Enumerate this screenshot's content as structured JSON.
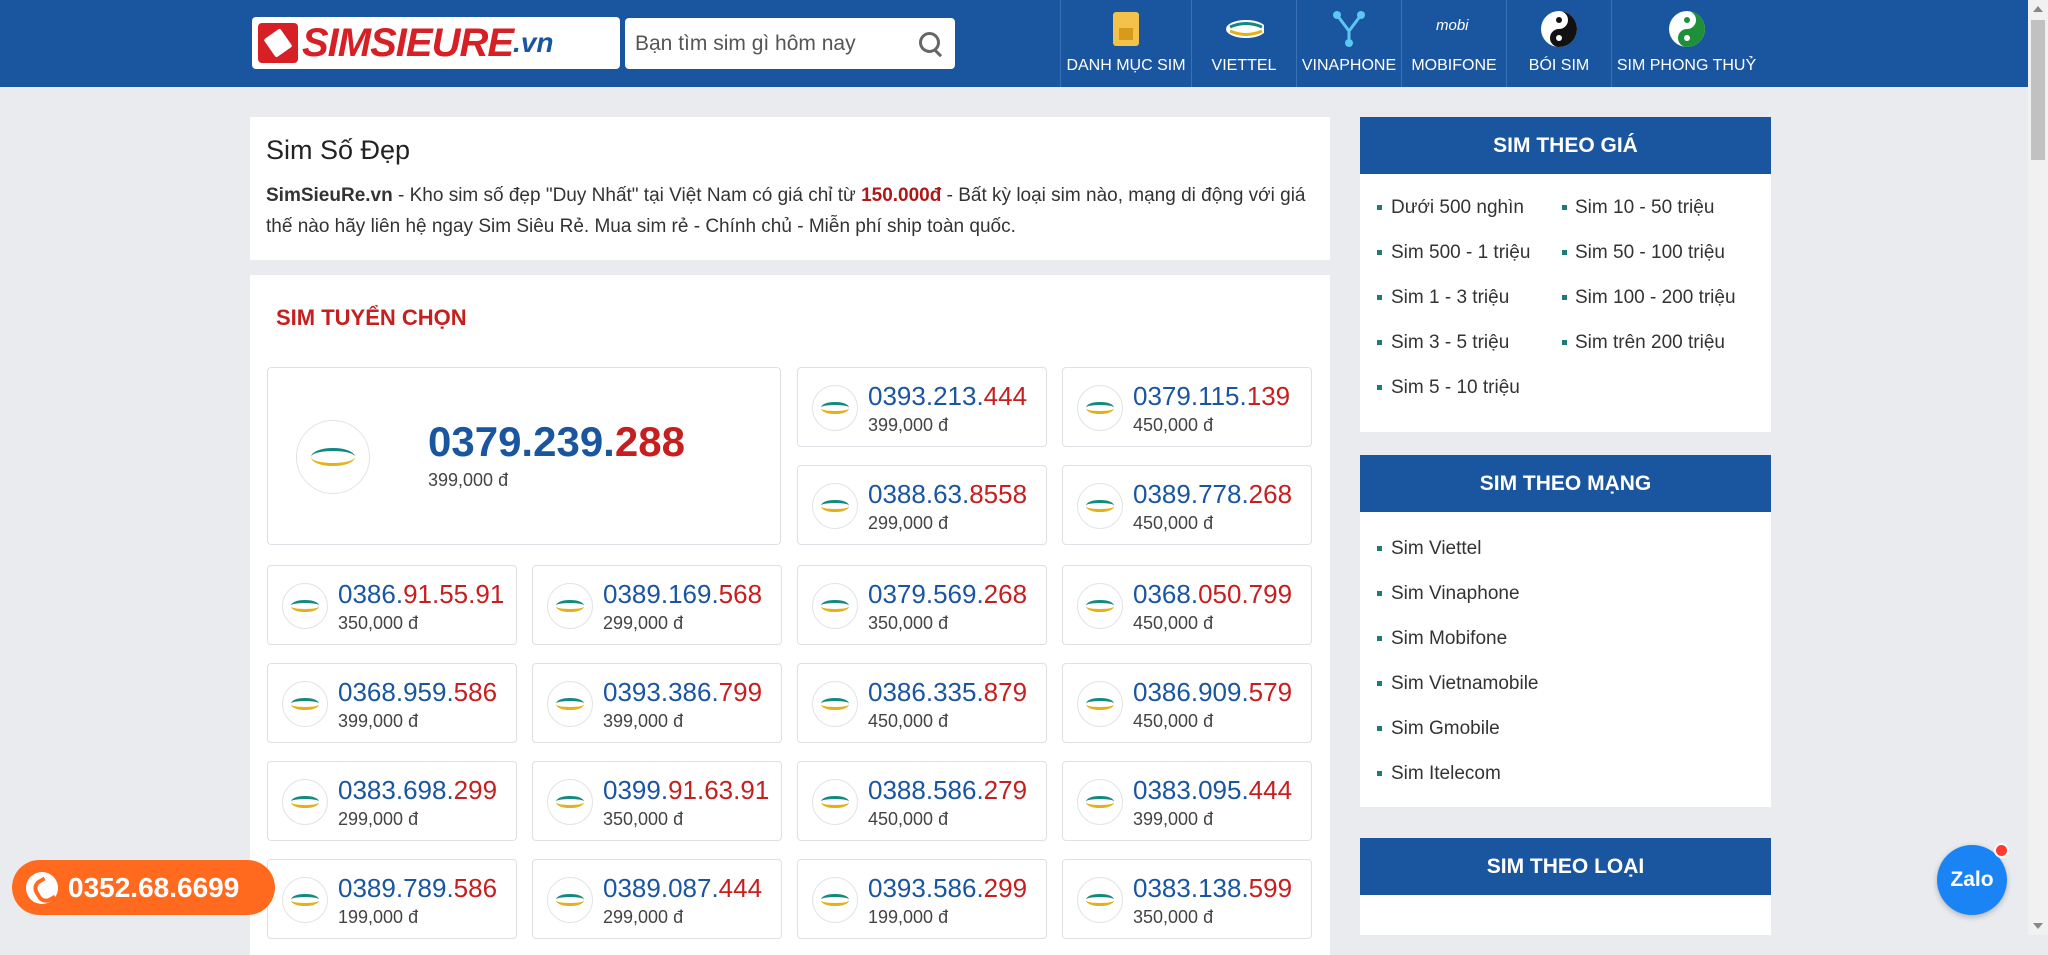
{
  "header": {
    "logo_text": "SIMSIEURE",
    "logo_suffix": ".vn",
    "search_placeholder": "Bạn tìm sim gì hôm nay",
    "nav": [
      {
        "label": "DANH MỤC SIM",
        "icon": "sim-card-icon"
      },
      {
        "label": "VIETTEL",
        "icon": "viettel-logo-icon"
      },
      {
        "label": "VINAPHONE",
        "icon": "vinaphone-logo-icon"
      },
      {
        "label": "MOBIFONE",
        "icon": "mobifone-logo-icon"
      },
      {
        "label": "BÓI SIM",
        "icon": "yin-yang-icon"
      },
      {
        "label": "SIM PHONG THUỶ",
        "icon": "yin-yang-green-icon"
      }
    ]
  },
  "intro": {
    "title": "Sim Số Đẹp",
    "brand": "SimSieuRe.vn",
    "text_1": " - Kho sim số đẹp \"Duy Nhất\" tại Việt Nam có giá chỉ từ ",
    "min_price": "150.000đ",
    "text_2": " - Bất kỳ loại sim nào, mạng di động với giá thế nào hãy liên hệ ngay Sim Siêu Rẻ. Mua sim rẻ - Chính chủ - Miễn phí ship toàn quốc."
  },
  "selection": {
    "title": "SIM TUYỂN CHỌN",
    "featured": {
      "prefix": "0379.239.",
      "highlight": "288",
      "price": "399,000 đ"
    },
    "cards": [
      {
        "prefix": "0393.213.",
        "highlight": "444",
        "price": "399,000 đ"
      },
      {
        "prefix": "0379.115.",
        "highlight": "139",
        "price": "450,000 đ"
      },
      {
        "prefix": "0388.63.",
        "highlight": "8558",
        "price": "299,000 đ"
      },
      {
        "prefix": "0389.778.",
        "highlight": "268",
        "price": "450,000 đ"
      },
      {
        "prefix": "0386.",
        "highlight": "91.55.91",
        "price": "350,000 đ"
      },
      {
        "prefix": "0389.169.",
        "highlight": "568",
        "price": "299,000 đ"
      },
      {
        "prefix": "0379.569.",
        "highlight": "268",
        "price": "350,000 đ"
      },
      {
        "prefix": "0368.",
        "highlight": "050.799",
        "price": "450,000 đ"
      },
      {
        "prefix": "0368.959.",
        "highlight": "586",
        "price": "399,000 đ"
      },
      {
        "prefix": "0393.386.",
        "highlight": "799",
        "price": "399,000 đ"
      },
      {
        "prefix": "0386.335.",
        "highlight": "879",
        "price": "450,000 đ"
      },
      {
        "prefix": "0386.909.",
        "highlight": "579",
        "price": "450,000 đ"
      },
      {
        "prefix": "0383.698.",
        "highlight": "299",
        "price": "299,000 đ"
      },
      {
        "prefix": "0399.",
        "highlight": "91.63.91",
        "price": "350,000 đ"
      },
      {
        "prefix": "0388.586.",
        "highlight": "279",
        "price": "450,000 đ"
      },
      {
        "prefix": "0383.095.",
        "highlight": "444",
        "price": "399,000 đ"
      },
      {
        "prefix": "0389.789.",
        "highlight": "586",
        "price": "199,000 đ"
      },
      {
        "prefix": "0389.087.",
        "highlight": "444",
        "price": "299,000 đ"
      },
      {
        "prefix": "0393.586.",
        "highlight": "299",
        "price": "199,000 đ"
      },
      {
        "prefix": "0383.138.",
        "highlight": "599",
        "price": "350,000 đ"
      }
    ]
  },
  "sidebar": {
    "by_price": {
      "title": "SIM THEO GIÁ",
      "col1": [
        "Dưới 500 nghìn",
        "Sim 500 - 1 triệu",
        "Sim 1 - 3 triệu",
        "Sim 3 - 5 triệu",
        "Sim 5 - 10 triệu"
      ],
      "col2": [
        "Sim 10 - 50 triệu",
        "Sim 50 - 100 triệu",
        "Sim 100 - 200 triệu",
        "Sim trên 200 triệu"
      ]
    },
    "by_network": {
      "title": "SIM THEO MẠNG",
      "items": [
        "Sim Viettel",
        "Sim Vinaphone",
        "Sim Mobifone",
        "Sim Vietnamobile",
        "Sim Gmobile",
        "Sim Itelecom"
      ]
    },
    "by_type": {
      "title": "SIM THEO LOẠI"
    }
  },
  "floating": {
    "hotline": "0352.68.6699",
    "zalo": "Zalo"
  },
  "colors": {
    "brand_blue": "#1a55a0",
    "accent_red": "#c51f1f",
    "hotline_orange": "#ff6a1f",
    "zalo_blue": "#1a84f5"
  }
}
